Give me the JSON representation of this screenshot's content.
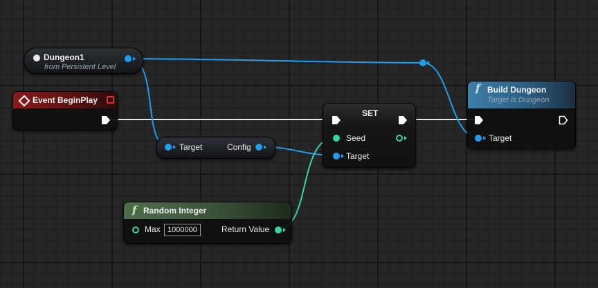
{
  "colors": {
    "object_wire": "#1f9ef0",
    "int_wire": "#35d6a4",
    "exec_wire": "#e8e8e8",
    "event_header": "#8a1a1a",
    "function_header": "#3d7fa8",
    "pure_function_header": "#40583f"
  },
  "nodes": {
    "dungeon_ref": {
      "title": "Dungeon1",
      "subtitle": "from Persistent Level"
    },
    "event_begin_play": {
      "title": "Event BeginPlay",
      "icon": "event-diamond-icon"
    },
    "set_node": {
      "title": "SET",
      "pin_seed": "Seed",
      "pin_target": "Target"
    },
    "build_dungeon": {
      "icon": "f",
      "title": "Build Dungeon",
      "subtitle": "Target is Dungeon",
      "pin_target": "Target"
    },
    "config_get": {
      "pin_target": "Target",
      "pin_config": "Config"
    },
    "random_integer": {
      "icon": "f",
      "title": "Random Integer",
      "pin_max": "Max",
      "max_value": "1000000",
      "pin_return": "Return Value"
    }
  }
}
